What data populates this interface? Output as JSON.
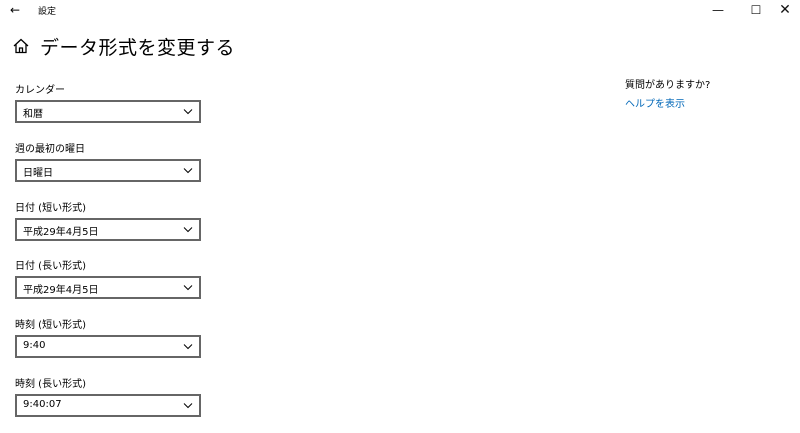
{
  "window": {
    "back_glyph": "←",
    "title": "設定",
    "minimize_glyph": "—",
    "maximize_glyph": "☐",
    "close_glyph": "✕"
  },
  "header": {
    "icon": "home-icon",
    "title": "データ形式を変更する"
  },
  "fields": [
    {
      "label": "カレンダー",
      "value": "和暦"
    },
    {
      "label": "週の最初の曜日",
      "value": "日曜日"
    },
    {
      "label": "日付 (短い形式)",
      "value": "平成29年4月5日"
    },
    {
      "label": "日付 (長い形式)",
      "value": "平成29年4月5日"
    },
    {
      "label": "時刻 (短い形式)",
      "value": "9:40"
    },
    {
      "label": "時刻 (長い形式)",
      "value": "9:40:07"
    }
  ],
  "help": {
    "question": "質問がありますか?",
    "link": "ヘルプを表示"
  },
  "colors": {
    "accent": "#0067b8",
    "dropdown_border": "#666666",
    "background": "#ffffff"
  }
}
